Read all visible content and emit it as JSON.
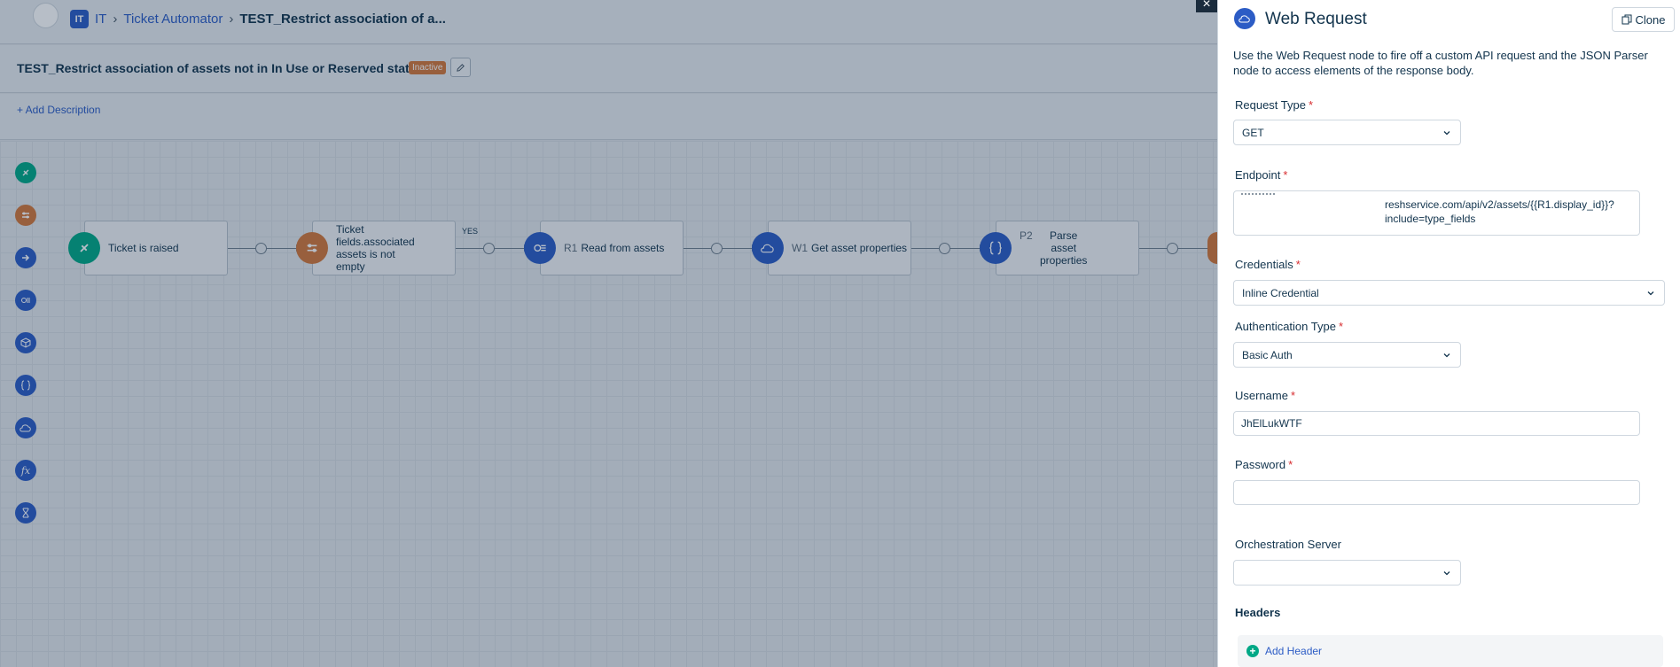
{
  "breadcrumb": {
    "workspace_badge": "IT",
    "workspace": "IT",
    "section": "Ticket Automator",
    "current": "TEST_Restrict association of a..."
  },
  "workflow": {
    "title": "TEST_Restrict association of assets not in In Use or Reserved states",
    "status": "Inactive",
    "add_description": "+ Add Description"
  },
  "palette": [
    {
      "icon": "event-icon",
      "color": "#00a886"
    },
    {
      "icon": "condition-icon",
      "color": "#d3783a"
    },
    {
      "icon": "action-icon",
      "color": "#2c5cc5"
    },
    {
      "icon": "read-icon",
      "color": "#2c5cc5"
    },
    {
      "icon": "app-icon",
      "color": "#2c5cc5"
    },
    {
      "icon": "json-parser-icon",
      "color": "#2c5cc5"
    },
    {
      "icon": "web-request-icon",
      "color": "#2c5cc5"
    },
    {
      "icon": "expression-icon",
      "color": "#2c5cc5"
    },
    {
      "icon": "timer-icon",
      "color": "#2c5cc5"
    }
  ],
  "nodes": [
    {
      "prefix": "",
      "label": "Ticket is raised",
      "icon": "event-icon",
      "color": "#00a886"
    },
    {
      "prefix": "",
      "label": "Ticket fields.associated assets is not empty",
      "icon": "condition-icon",
      "color": "#d3783a"
    },
    {
      "prefix": "R1",
      "label": "Read from assets",
      "icon": "read-icon",
      "color": "#2c5cc5"
    },
    {
      "prefix": "W1",
      "label": "Get asset properties",
      "icon": "web-request-icon",
      "color": "#2c5cc5"
    },
    {
      "prefix": "P2",
      "label": "Parse asset properties",
      "icon": "json-parser-icon",
      "color": "#2c5cc5"
    }
  ],
  "branch_label": "YES",
  "drawer": {
    "title": "Web Request",
    "clone_label": "Clone",
    "description": "Use the Web Request node to fire off a custom API request and the JSON Parser node to access elements of the response body.",
    "request_type": {
      "label": "Request Type",
      "value": "GET"
    },
    "endpoint": {
      "label": "Endpoint",
      "value": "reshservice.com/api/v2/assets/{{R1.display_id}}?include=type_fields"
    },
    "credentials": {
      "label": "Credentials",
      "value": "Inline Credential"
    },
    "auth_type": {
      "label": "Authentication Type",
      "value": "Basic Auth"
    },
    "username": {
      "label": "Username",
      "value": "JhElLukWTF"
    },
    "password": {
      "label": "Password",
      "value": ""
    },
    "orchestration": {
      "label": "Orchestration Server",
      "value": ""
    },
    "headers_title": "Headers",
    "add_header": "Add Header",
    "placeholder_button": "{+}",
    "required_mark": "*"
  }
}
